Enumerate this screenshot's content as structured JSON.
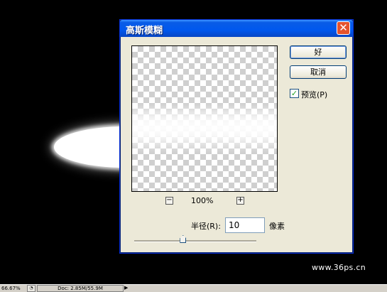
{
  "dialog": {
    "title": "高斯模糊",
    "close_glyph": "✕",
    "ok_label": "好",
    "cancel_label": "取消",
    "preview_label": "预览(P)",
    "preview_checked": true,
    "zoom_out_glyph": "−",
    "zoom_in_glyph": "+",
    "zoom_level": "100%",
    "radius_label": "半径(R):",
    "radius_value": "10",
    "radius_unit": "像素",
    "slider_position_fraction": 0.4
  },
  "watermark": "www.36ps.cn",
  "statusbar": {
    "zoom": "66.67%",
    "doc": "Doc: 2.85M/55.9M",
    "arrow_glyph": "▶"
  },
  "icons": {
    "close": "close-icon",
    "zoom_out": "zoom-out-icon",
    "zoom_in": "zoom-in-icon",
    "checkbox": "checkmark-icon"
  },
  "colors": {
    "titlebar": "#0058ee",
    "close_button": "#e5532d",
    "dialog_bg": "#ece9d8",
    "canvas_bg": "#000000"
  }
}
